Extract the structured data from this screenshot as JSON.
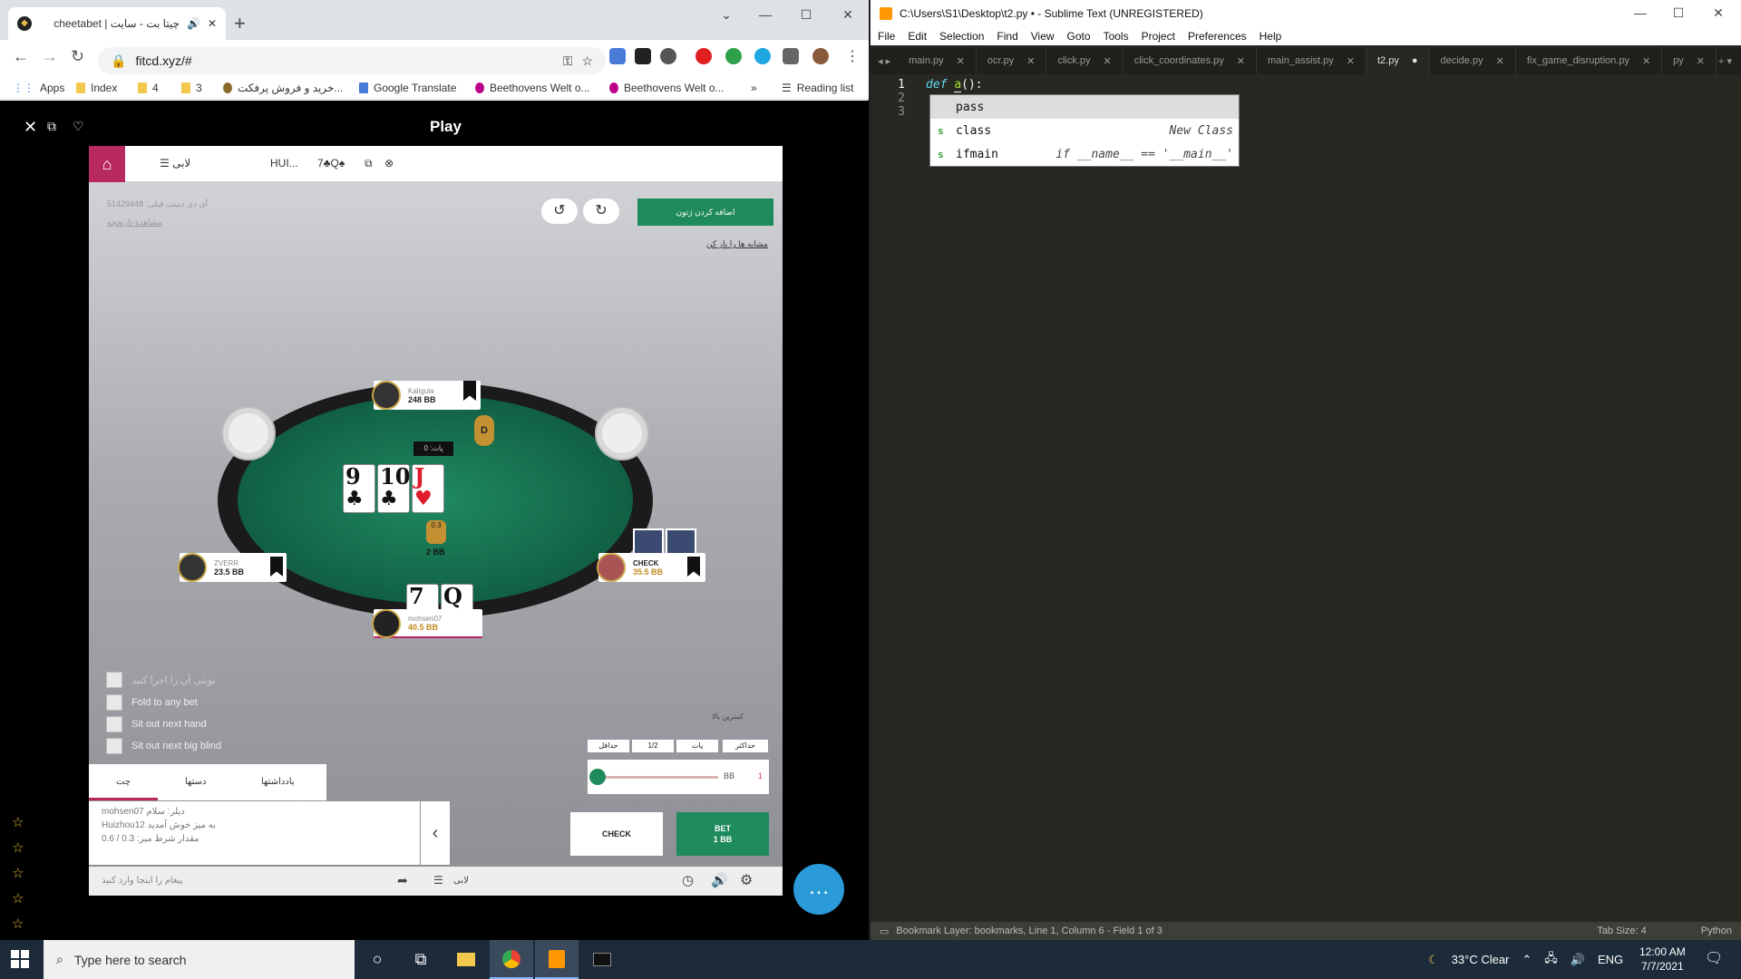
{
  "chrome": {
    "tab_title": "چیتا بت - سایت | cheetabet",
    "url": "fitcd.xyz/#",
    "bookmarks": [
      {
        "label": "Apps"
      },
      {
        "label": "Index"
      },
      {
        "label": "4"
      },
      {
        "label": "3"
      },
      {
        "label": "خرید و فروش پرفکت..."
      },
      {
        "label": "Google Translate"
      },
      {
        "label": "Beethovens Welt o..."
      },
      {
        "label": "Beethovens Welt o..."
      },
      {
        "label": "»"
      },
      {
        "label": "Reading list"
      }
    ],
    "page_title": "Play"
  },
  "game": {
    "tabs": {
      "lobby": "لابی",
      "table": "HUI...",
      "hand": "7♣Q♠"
    },
    "faint_top": "51429448 :آی دی دست قبلی",
    "faint_link": "مشاهده تاریخچه",
    "green_button": "اضافه کردن ژتون",
    "link_text": "مشابه ها را باز کن",
    "players": [
      {
        "name": "Kaligula",
        "chips": "248 BB"
      },
      {
        "name": "ZVERR",
        "chips": "23.5 BB"
      },
      {
        "name": "CHECK",
        "chips": "35.5 BB"
      },
      {
        "name": "mohsen07",
        "chips": "40.5 BB"
      }
    ],
    "dealer": "D",
    "pot_label": "پات: 0",
    "board": [
      {
        "rank": "9",
        "suit": "♣",
        "color": "#111111"
      },
      {
        "rank": "10",
        "suit": "♣",
        "color": "#111111"
      },
      {
        "rank": "J",
        "suit": "♥",
        "color": "#e01b2b"
      }
    ],
    "hero_cards": [
      {
        "rank": "7",
        "suit": "♣",
        "color": "#111111"
      },
      {
        "rank": "Q",
        "suit": "♠",
        "color": "#111111"
      }
    ],
    "chip_value": "0.3",
    "bet_amount": "2 BB",
    "options": [
      "نوبتی آن را اجرا کنید",
      "Fold to any bet",
      "Sit out next hand",
      "Sit out next big blind"
    ],
    "min_label": "کمترین بالا",
    "presets": [
      "حداقل",
      "1/2",
      "پات",
      "حداکثر"
    ],
    "bb_label": "BB",
    "bb_value": "1",
    "check_label": "CHECK",
    "bet_label": "BET",
    "bet_value": "1 BB",
    "chat_tabs": [
      "چت",
      "دستها",
      "یادداشتها"
    ],
    "chat_lines": [
      "mohsen07 دیلر: سلام",
      "Huizhou12 به میز خوش آمدید",
      "0.6 / 0.3 :مقدار شرط میز"
    ],
    "chat_placeholder": "پیغام را اینجا وارد کنید",
    "lobby_footer": "لابی"
  },
  "sublime": {
    "title": "C:\\Users\\S1\\Desktop\\t2.py • - Sublime Text (UNREGISTERED)",
    "menu": [
      "File",
      "Edit",
      "Selection",
      "Find",
      "View",
      "Goto",
      "Tools",
      "Project",
      "Preferences",
      "Help"
    ],
    "tabs": [
      {
        "label": "main.py",
        "active": false
      },
      {
        "label": "ocr.py",
        "active": false
      },
      {
        "label": "click.py",
        "active": false
      },
      {
        "label": "click_coordinates.py",
        "active": false
      },
      {
        "label": "main_assist.py",
        "active": false
      },
      {
        "label": "t2.py",
        "active": true
      },
      {
        "label": "decide.py",
        "active": false
      },
      {
        "label": "fix_game_disruption.py",
        "active": false
      },
      {
        "label": "py",
        "active": false
      }
    ],
    "line_numbers": [
      "1",
      "2",
      "3"
    ],
    "code_keyword": "def",
    "code_name": "a",
    "code_rest": "():",
    "autocomplete": [
      {
        "kind": "",
        "label": "pass",
        "hint": ""
      },
      {
        "kind": "s",
        "label": "class",
        "hint": "New Class"
      },
      {
        "kind": "s",
        "label": "ifmain",
        "hint": "if __name__ == '__main__'"
      }
    ],
    "status_left": "Bookmark Layer: bookmarks, Line 1, Column 6 - Field 1 of 3",
    "tab_size": "Tab Size: 4",
    "syntax": "Python"
  },
  "taskbar": {
    "search_placeholder": "Type here to search",
    "weather": "33°C  Clear",
    "language": "ENG",
    "time": "12:00 AM",
    "date": "7/7/2021"
  }
}
